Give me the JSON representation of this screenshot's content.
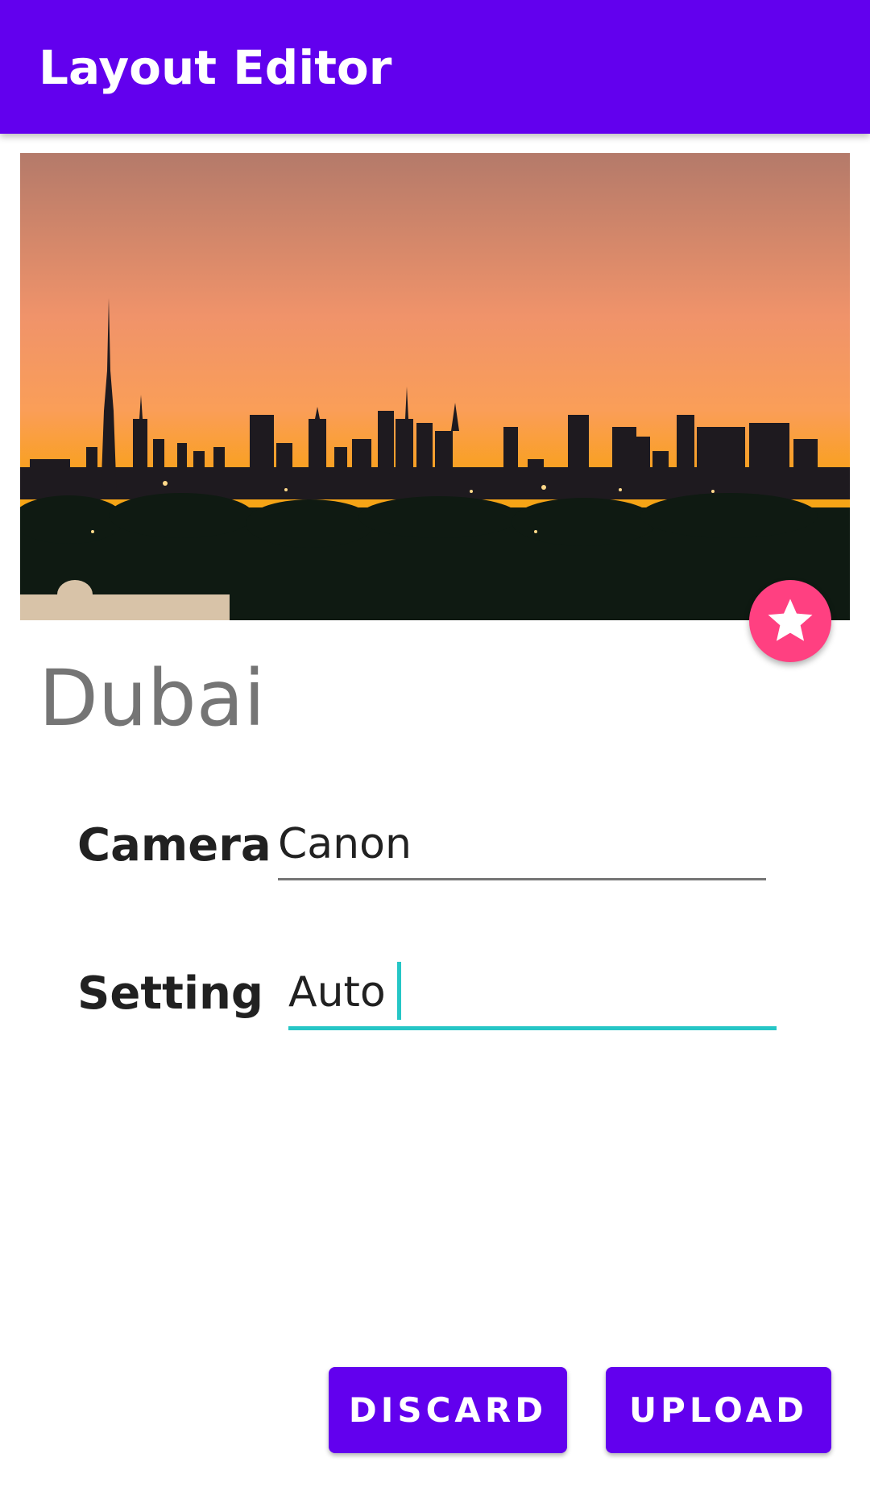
{
  "app_bar": {
    "title": "Layout Editor"
  },
  "hero_image": {
    "subject": "Dubai skyline at sunset"
  },
  "favorite_fab": {
    "icon": "star-icon"
  },
  "place": {
    "title": "Dubai"
  },
  "form": {
    "camera": {
      "label": "Camera",
      "value": "Canon"
    },
    "setting": {
      "label": "Setting",
      "value": "Auto"
    }
  },
  "actions": {
    "discard_label": "DISCARD",
    "upload_label": "UPLOAD"
  },
  "colors": {
    "primary": "#6200ee",
    "accent": "#ff4081",
    "focus_underline": "#26c6c6"
  }
}
